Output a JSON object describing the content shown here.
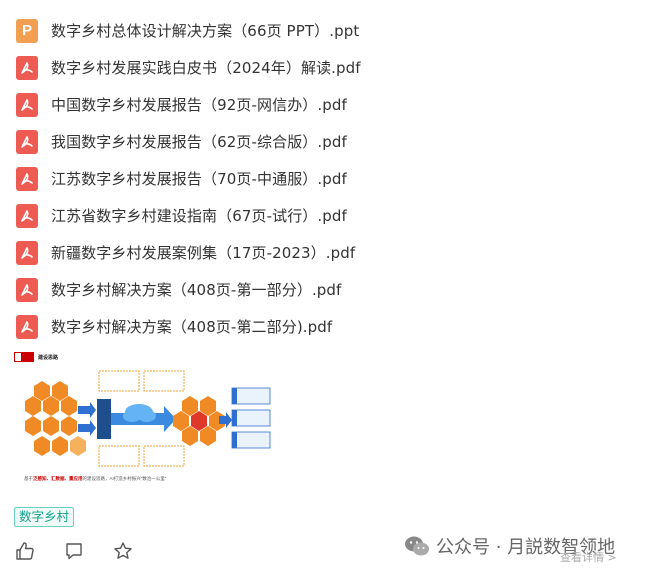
{
  "files": [
    {
      "type": "ppt",
      "letter": "P",
      "name": "数字乡村总体设计解决方案（66页 PPT）.ppt"
    },
    {
      "type": "pdf",
      "name": "数字乡村发展实践白皮书（2024年）解读.pdf"
    },
    {
      "type": "pdf",
      "name": "中国数字乡村发展报告（92页-网信办）.pdf"
    },
    {
      "type": "pdf",
      "name": "我国数字乡村发展报告（62页-综合版）.pdf"
    },
    {
      "type": "pdf",
      "name": "江苏数字乡村发展报告（70页-中通服）.pdf"
    },
    {
      "type": "pdf",
      "name": "江苏省数字乡村建设指南（67页-试行）.pdf"
    },
    {
      "type": "pdf",
      "name": "新疆数字乡村发展案例集（17页-2023）.pdf"
    },
    {
      "type": "pdf",
      "name": "数字乡村解决方案（408页-第一部分）.pdf"
    },
    {
      "type": "pdf",
      "name": "数字乡村解决方案（408页-第二部分).pdf"
    }
  ],
  "figure": {
    "title": "建设思路",
    "caption_pre": "基于",
    "caption_hl": "泛感知、汇数据、重应用",
    "caption_post": "的建设思路，AI打造乡村振兴“数治一公里”"
  },
  "tag": "数字乡村",
  "actions": [
    "like-icon",
    "comment-icon",
    "star-icon"
  ],
  "watermark": {
    "text": "公众号 · 月説数智领地"
  },
  "read_more": "查看详情 >",
  "colors": {
    "ppt": "#f0a050",
    "pdf": "#ee5b52",
    "tag_text": "#14a38b",
    "hex": "#f08a24",
    "accent_blue": "#2f6fd1"
  }
}
